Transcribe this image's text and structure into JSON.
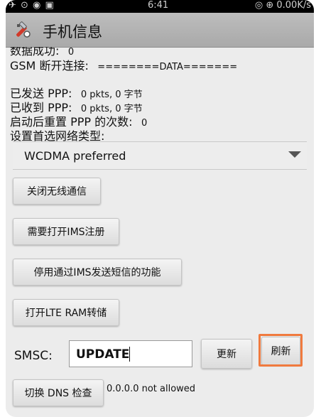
{
  "statusbar": {
    "left": "✈ ⊙ ◉ ▣",
    "time": "6:41",
    "right": "◎ ⊕ 0.00K/s"
  },
  "app": {
    "title": "手机信息"
  },
  "info": {
    "data_success": {
      "label": "数据成功:",
      "value": "0"
    },
    "gsm_disconnect": {
      "label": "GSM 断开连接:",
      "value": "========DATA======="
    },
    "ppp_sent": {
      "label": "已发送 PPP:",
      "value": "0 pkts, 0 字节"
    },
    "ppp_received": {
      "label": "已收到 PPP:",
      "value": "0 pkts, 0 字节"
    },
    "ppp_reset": {
      "label": "启动后重置 PPP 的次数:",
      "value": "0"
    },
    "network_type": {
      "label": "设置首选网络类型:"
    }
  },
  "network_spinner": {
    "selected": "WCDMA preferred"
  },
  "buttons": {
    "radio_off": "关闭无线通信",
    "ims_register": "需要打开IMS注册",
    "disable_sms_ims": "停用通过IMS发送短信的功能",
    "lte_ram_dump": "打开LTE RAM转储",
    "update": "更新",
    "refresh": "刷新",
    "dns_check": "切换 DNS 检查"
  },
  "smsc": {
    "label": "SMSC:",
    "value": "UPDATE"
  },
  "dns": {
    "status": "0.0.0.0 not allowed"
  },
  "colors": {
    "highlight": "#f07a3e",
    "titlebar": "#b5b5b5",
    "background": "#ececec"
  }
}
